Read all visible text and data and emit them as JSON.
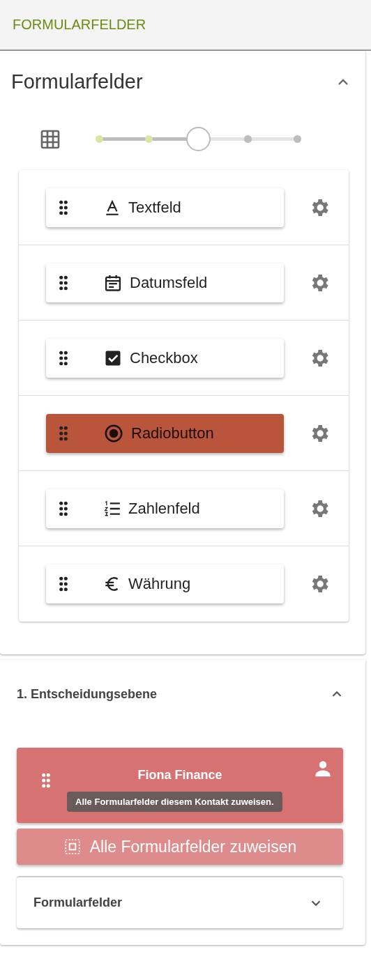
{
  "header": {
    "title": "FORMULARFELDER"
  },
  "fields_panel": {
    "title": "Formularfelder",
    "expanded": true,
    "slider": {
      "level": 0.5
    },
    "items": [
      {
        "kind": "text",
        "label": "Textfeld",
        "selected": false
      },
      {
        "kind": "date",
        "label": "Datumsfeld",
        "selected": false
      },
      {
        "kind": "checkbox",
        "label": "Checkbox",
        "selected": false
      },
      {
        "kind": "radio",
        "label": "Radiobutton",
        "selected": true
      },
      {
        "kind": "number",
        "label": "Zahlenfeld",
        "selected": false
      },
      {
        "kind": "currency",
        "label": "Währung",
        "selected": false
      }
    ]
  },
  "level_panel": {
    "title": "1. Entscheidungsebene",
    "expanded": true,
    "contact": {
      "name": "Fiona Finance",
      "tooltip": "Alle Formularfelder diesem Kontakt zuweisen."
    },
    "assign_button": "Alle Formularfelder zuweisen",
    "sub_panel": {
      "title": "Formularfelder",
      "expanded": false
    }
  }
}
